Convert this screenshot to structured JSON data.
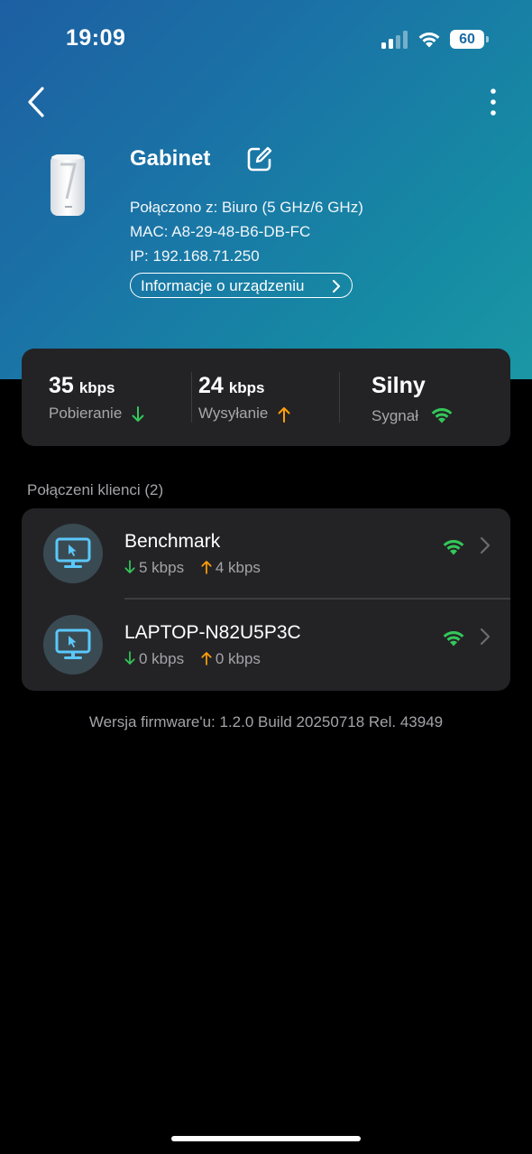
{
  "status_bar": {
    "time": "19:09",
    "battery": "60",
    "signal_icon": "cellular-signal-icon",
    "wifi_icon": "wifi-icon"
  },
  "nav": {
    "back_icon": "chevron-left-icon",
    "more_icon": "more-vertical-icon"
  },
  "device": {
    "name": "Gabinet",
    "connected_to": "Połączono z: Biuro (5 GHz/6 GHz)",
    "mac": "MAC: A8-29-48-B6-DB-FC",
    "ip": "IP: 192.168.71.250",
    "info_button": "Informacje o urządzeniu"
  },
  "stats": {
    "download": {
      "value": "35",
      "unit": "kbps",
      "label": "Pobieranie"
    },
    "upload": {
      "value": "24",
      "unit": "kbps",
      "label": "Wysyłanie"
    },
    "signal": {
      "value": "Silny",
      "label": "Sygnał"
    }
  },
  "clients": {
    "title": "Połączeni klienci (2)",
    "items": [
      {
        "name": "Benchmark",
        "down": "5 kbps",
        "up": "4 kbps"
      },
      {
        "name": "LAPTOP-N82U5P3C",
        "down": "0 kbps",
        "up": "0 kbps"
      }
    ]
  },
  "firmware": "Wersja firmware'u: 1.2.0 Build 20250718 Rel. 43949",
  "colors": {
    "green": "#34c759",
    "orange": "#ff9f0a",
    "card": "#232326",
    "accent_blue": "#5ac8fa"
  }
}
